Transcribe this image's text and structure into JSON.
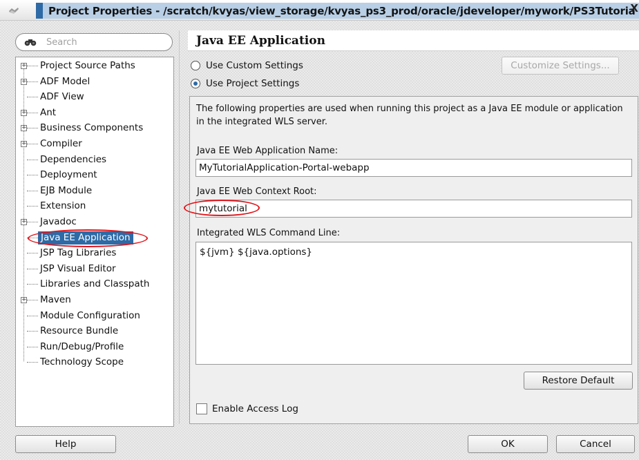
{
  "window": {
    "title": "Project Properties - /scratch/kvyas/view_storage/kvyas_ps3_prod/oracle/jdeveloper/mywork/PS3Tutoria",
    "close_glyph": "X"
  },
  "search": {
    "placeholder": "Search"
  },
  "tree": {
    "items": [
      {
        "label": "Project Source Paths",
        "expandable": true
      },
      {
        "label": "ADF Model",
        "expandable": true
      },
      {
        "label": "ADF View",
        "expandable": false
      },
      {
        "label": "Ant",
        "expandable": true
      },
      {
        "label": "Business Components",
        "expandable": true
      },
      {
        "label": "Compiler",
        "expandable": true
      },
      {
        "label": "Dependencies",
        "expandable": false
      },
      {
        "label": "Deployment",
        "expandable": false
      },
      {
        "label": "EJB Module",
        "expandable": false
      },
      {
        "label": "Extension",
        "expandable": false
      },
      {
        "label": "Javadoc",
        "expandable": true
      },
      {
        "label": "Java EE Application",
        "expandable": false,
        "selected": true
      },
      {
        "label": "JSP Tag Libraries",
        "expandable": false
      },
      {
        "label": "JSP Visual Editor",
        "expandable": false
      },
      {
        "label": "Libraries and Classpath",
        "expandable": false
      },
      {
        "label": "Maven",
        "expandable": true
      },
      {
        "label": "Module Configuration",
        "expandable": false
      },
      {
        "label": "Resource Bundle",
        "expandable": false
      },
      {
        "label": "Run/Debug/Profile",
        "expandable": false
      },
      {
        "label": "Technology Scope",
        "expandable": false
      }
    ]
  },
  "panel": {
    "title": "Java EE Application",
    "use_custom_label": "Use Custom Settings",
    "use_project_label": "Use Project Settings",
    "customize_button": "Customize Settings...",
    "description": "The following properties are used when running this project as a Java EE module or application in the integrated WLS server.",
    "webapp_name_label": "Java EE Web Application Name:",
    "webapp_name_value": "MyTutorialApplication-Portal-webapp",
    "context_root_label": "Java EE Web Context Root:",
    "context_root_value": "mytutorial",
    "command_line_label": "Integrated WLS Command Line:",
    "command_line_value": "${jvm} ${java.options}",
    "restore_button": "Restore Default",
    "access_log_label": "Enable Access Log"
  },
  "footer": {
    "help": "Help",
    "ok": "OK",
    "cancel": "Cancel"
  },
  "colors": {
    "selection": "#2e6aa5",
    "annotation": "#e1141a",
    "title_highlight": "#b8cfe6"
  }
}
